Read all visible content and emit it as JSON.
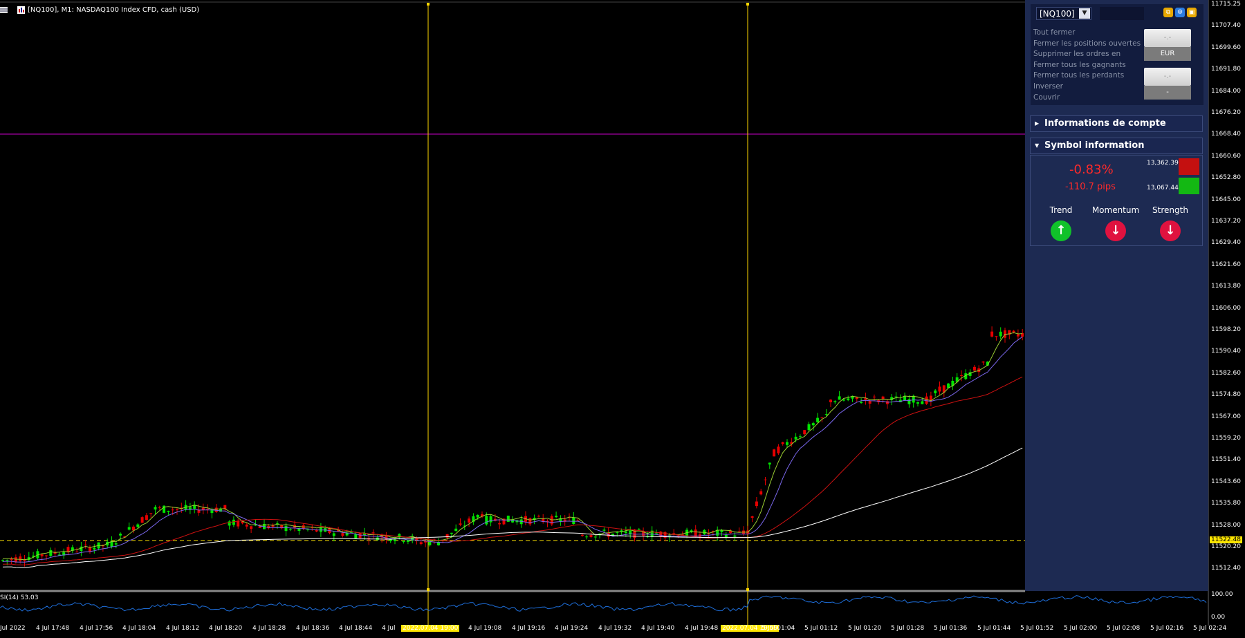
{
  "window": {
    "title": "[NQ100], M1:  NASDAQ100 Index CFD, cash (USD)"
  },
  "panel": {
    "symbol": "[NQ100]",
    "menu_items": [
      "Tout fermer",
      "Fermer les positions ouvertes",
      "Supprimer les ordres en",
      "Fermer tous les gagnants",
      "Fermer tous les perdants",
      "Inverser",
      "Couvrir"
    ],
    "box1_value": "-.-",
    "box1_currency": "EUR",
    "box2_value": "-.-",
    "box2_sub": "-",
    "account_section": "Informations de compte",
    "symbol_section": "Symbol information",
    "change_pct": "-0.83%",
    "change_pips": "-110.7 pips",
    "high": "13,362.39",
    "low": "13,067.44",
    "indicators": [
      {
        "label": "Trend",
        "direction": "up"
      },
      {
        "label": "Momentum",
        "direction": "down"
      },
      {
        "label": "Strength",
        "direction": "down"
      }
    ]
  },
  "price_axis": [
    "11715.25",
    "11707.40",
    "11699.60",
    "11691.80",
    "11684.00",
    "11676.20",
    "11668.40",
    "11660.60",
    "11652.80",
    "11645.00",
    "11637.20",
    "11629.40",
    "11621.60",
    "11613.80",
    "11606.00",
    "11598.20",
    "11590.40",
    "11582.60",
    "11574.80",
    "11567.00",
    "11559.20",
    "11551.40",
    "11543.60",
    "11535.80",
    "11528.00",
    "11520.20",
    "11512.40"
  ],
  "current_price": "11522.48",
  "rsi": {
    "label": "SI(14) 53.03",
    "axis": [
      "100.00",
      "0.00"
    ]
  },
  "time_axis": [
    "Jul 2022",
    "4 Jul 17:48",
    "4 Jul 17:56",
    "4 Jul 18:04",
    "4 Jul 18:12",
    "4 Jul 18:20",
    "4 Jul 18:28",
    "4 Jul 18:36",
    "4 Jul 18:44",
    "4 Jul",
    "2022.07.04 19:00",
    "4 Jul 19:08",
    "4 Jul 19:16",
    "4 Jul 19:24",
    "4 Jul 19:32",
    "4 Jul 19:40",
    "4 Jul 19:48",
    "2022.07.04 19:59",
    "5 Jul 01:04",
    "5 Jul 01:12",
    "5 Jul 01:20",
    "5 Jul 01:28",
    "5 Jul 01:36",
    "5 Jul 01:44",
    "5 Jul 01:52",
    "5 Jul 02:00",
    "5 Jul 02:08",
    "5 Jul 02:16",
    "5 Jul 02:24"
  ],
  "colors": {
    "bull": "#00e600",
    "bear": "#e60000",
    "ma_fast": "#9acd32",
    "ma_mid": "#7b68ee",
    "ma_slow": "#cc1111",
    "ma_long": "#ffffff",
    "vline": "#ffd700",
    "hline": "#cc00cc",
    "rsi": "#1e6fdc"
  }
}
